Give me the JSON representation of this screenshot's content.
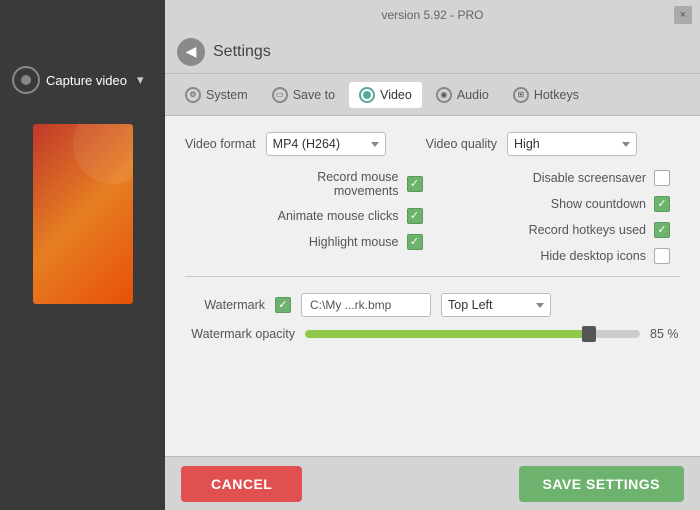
{
  "app": {
    "version": "version 5.92 - PRO",
    "close_btn": "×"
  },
  "sidebar": {
    "logo_char": "▶",
    "capture_label": "Capture video",
    "capture_arrow": "▾"
  },
  "settings": {
    "back_icon": "◀",
    "title": "Settings"
  },
  "tabs": [
    {
      "id": "system",
      "label": "System",
      "active": false
    },
    {
      "id": "save-to",
      "label": "Save to",
      "active": false
    },
    {
      "id": "video",
      "label": "Video",
      "active": true
    },
    {
      "id": "audio",
      "label": "Audio",
      "active": false
    },
    {
      "id": "hotkeys",
      "label": "Hotkeys",
      "active": false
    }
  ],
  "video_settings": {
    "video_format_label": "Video format",
    "video_format_value": "MP4 (H264)",
    "video_quality_label": "Video quality",
    "video_quality_value": "High",
    "checkboxes_left": [
      {
        "id": "record-mouse",
        "label": "Record mouse\nmovements",
        "checked": true
      },
      {
        "id": "animate-mouse",
        "label": "Animate mouse clicks",
        "checked": true
      },
      {
        "id": "highlight-mouse",
        "label": "Highlight mouse",
        "checked": true
      }
    ],
    "checkboxes_right": [
      {
        "id": "disable-screensaver",
        "label": "Disable screensaver",
        "checked": false
      },
      {
        "id": "show-countdown",
        "label": "Show countdown",
        "checked": true
      },
      {
        "id": "record-hotkeys",
        "label": "Record hotkeys used",
        "checked": true
      },
      {
        "id": "hide-desktop",
        "label": "Hide desktop icons",
        "checked": false
      }
    ],
    "watermark_label": "Watermark",
    "watermark_checked": true,
    "watermark_path": "C:\\My ...rk.bmp",
    "watermark_position_label": "Top Left",
    "watermark_opacity_label": "Watermark opacity",
    "watermark_opacity_value": "85 %"
  },
  "buttons": {
    "cancel_label": "CANCEL",
    "save_label": "SAVE SETTINGS"
  }
}
